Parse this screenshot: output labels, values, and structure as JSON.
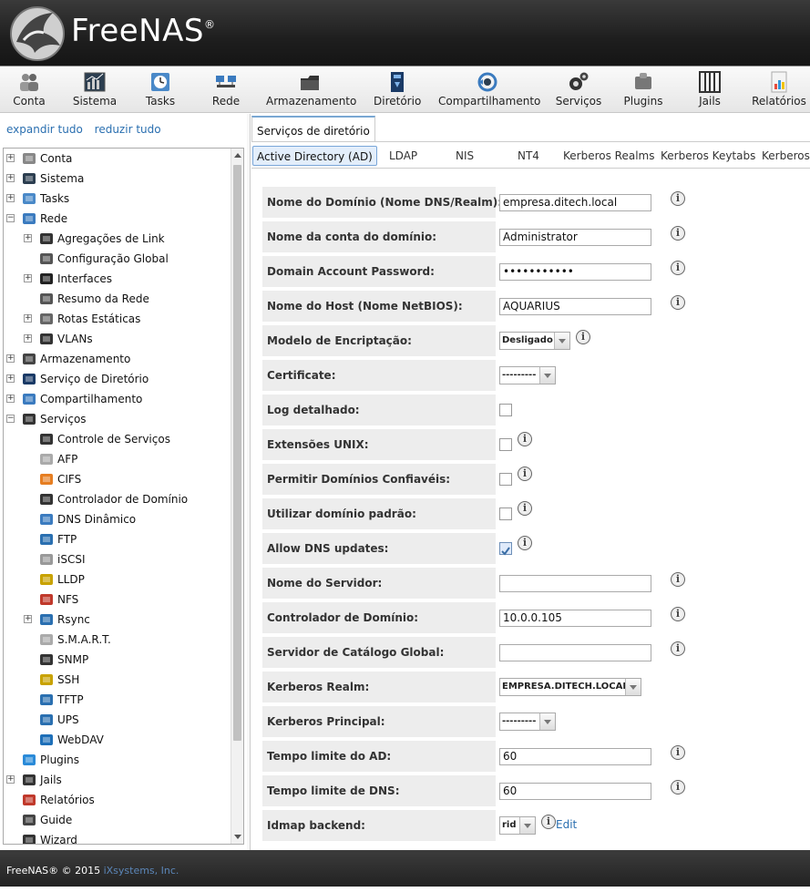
{
  "brand": {
    "name": "FreeNAS",
    "reg": "®"
  },
  "toolbar": [
    {
      "label": "Conta",
      "icon": "users-icon"
    },
    {
      "label": "Sistema",
      "icon": "system-icon"
    },
    {
      "label": "Tasks",
      "icon": "tasks-icon"
    },
    {
      "label": "Rede",
      "icon": "network-icon"
    },
    {
      "label": "Armazenamento",
      "icon": "storage-icon"
    },
    {
      "label": "Diretório",
      "icon": "directory-icon"
    },
    {
      "label": "Compartilhamento",
      "icon": "sharing-icon"
    },
    {
      "label": "Serviços",
      "icon": "services-icon"
    },
    {
      "label": "Plugins",
      "icon": "plugins-icon"
    },
    {
      "label": "Jails",
      "icon": "jails-icon"
    },
    {
      "label": "Relatórios",
      "icon": "reports-icon"
    }
  ],
  "sidebar": {
    "expand_all": "expandir tudo",
    "collapse_all": "reduzir tudo",
    "tree": [
      {
        "label": "Conta",
        "level": 0,
        "exp": "+",
        "icon": "users-icon"
      },
      {
        "label": "Sistema",
        "level": 0,
        "exp": "+",
        "icon": "system-icon"
      },
      {
        "label": "Tasks",
        "level": 0,
        "exp": "+",
        "icon": "tasks-icon"
      },
      {
        "label": "Rede",
        "level": 0,
        "exp": "-",
        "icon": "network-icon"
      },
      {
        "label": "Agregações de Link",
        "level": 1,
        "exp": "+",
        "icon": "link-aggregation-icon"
      },
      {
        "label": "Configuração Global",
        "level": 1,
        "exp": "",
        "icon": "wrench-icon"
      },
      {
        "label": "Interfaces",
        "level": 1,
        "exp": "+",
        "icon": "interface-icon"
      },
      {
        "label": "Resumo da Rede",
        "level": 1,
        "exp": "",
        "icon": "wrench-icon"
      },
      {
        "label": "Rotas Estáticas",
        "level": 1,
        "exp": "+",
        "icon": "routes-icon"
      },
      {
        "label": "VLANs",
        "level": 1,
        "exp": "+",
        "icon": "vlan-icon"
      },
      {
        "label": "Armazenamento",
        "level": 0,
        "exp": "+",
        "icon": "storage-icon"
      },
      {
        "label": "Serviço de Diretório",
        "level": 0,
        "exp": "+",
        "icon": "directory-icon"
      },
      {
        "label": "Compartilhamento",
        "level": 0,
        "exp": "+",
        "icon": "sharing-icon"
      },
      {
        "label": "Serviços",
        "level": 0,
        "exp": "-",
        "icon": "services-icon"
      },
      {
        "label": "Controle de Serviços",
        "level": 1,
        "exp": "",
        "icon": "services-icon"
      },
      {
        "label": "AFP",
        "level": 1,
        "exp": "",
        "icon": "apple-icon"
      },
      {
        "label": "CIFS",
        "level": 1,
        "exp": "",
        "icon": "windows-icon"
      },
      {
        "label": "Controlador de Domínio",
        "level": 1,
        "exp": "",
        "icon": "domain-controller-icon"
      },
      {
        "label": "DNS Dinâmico",
        "level": 1,
        "exp": "",
        "icon": "network-icon"
      },
      {
        "label": "FTP",
        "level": 1,
        "exp": "",
        "icon": "ftp-icon"
      },
      {
        "label": "iSCSI",
        "level": 1,
        "exp": "",
        "icon": "iscsi-icon"
      },
      {
        "label": "LLDP",
        "level": 1,
        "exp": "",
        "icon": "magnifier-icon"
      },
      {
        "label": "NFS",
        "level": 1,
        "exp": "",
        "icon": "nfs-icon"
      },
      {
        "label": "Rsync",
        "level": 1,
        "exp": "+",
        "icon": "rsync-icon"
      },
      {
        "label": "S.M.A.R.T.",
        "level": 1,
        "exp": "",
        "icon": "smart-icon"
      },
      {
        "label": "SNMP",
        "level": 1,
        "exp": "",
        "icon": "snmp-icon"
      },
      {
        "label": "SSH",
        "level": 1,
        "exp": "",
        "icon": "ssh-icon"
      },
      {
        "label": "TFTP",
        "level": 1,
        "exp": "",
        "icon": "tftp-icon"
      },
      {
        "label": "UPS",
        "level": 1,
        "exp": "",
        "icon": "ups-icon"
      },
      {
        "label": "WebDAV",
        "level": 1,
        "exp": "",
        "icon": "globe-icon"
      },
      {
        "label": "Plugins",
        "level": 0,
        "exp": "",
        "icon": "plugins-icon"
      },
      {
        "label": "Jails",
        "level": 0,
        "exp": "+",
        "icon": "jails-icon"
      },
      {
        "label": "Relatórios",
        "level": 0,
        "exp": "",
        "icon": "reports-icon"
      },
      {
        "label": "Guide",
        "level": 0,
        "exp": "",
        "icon": "guide-icon"
      },
      {
        "label": "Wizard",
        "level": 0,
        "exp": "",
        "icon": "wizard-icon"
      }
    ]
  },
  "main": {
    "tab": "Serviços de diretório",
    "subtabs": [
      "Active Directory (AD)",
      "LDAP",
      "NIS",
      "NT4",
      "Kerberos Realms",
      "Kerberos Keytabs",
      "Kerberos"
    ],
    "active_subtab": 0,
    "fields": [
      {
        "label": "Nome do Domínio (Nome DNS/Realm):",
        "type": "text",
        "value": "empresa.ditech.local",
        "info": true
      },
      {
        "label": "Nome da conta do domínio:",
        "type": "text",
        "value": "Administrator",
        "info": true
      },
      {
        "label": "Domain Account Password:",
        "type": "password",
        "value": "•••••••••••",
        "info": true
      },
      {
        "label": "Nome do Host (Nome NetBIOS):",
        "type": "text",
        "value": "AQUARIUS",
        "info": true
      },
      {
        "label": "Modelo de Encriptação:",
        "type": "select",
        "value": "Desligado",
        "info": true
      },
      {
        "label": "Certificate:",
        "type": "select",
        "value": "---------",
        "info": false
      },
      {
        "label": "Log detalhado:",
        "type": "checkbox",
        "checked": false,
        "info": false
      },
      {
        "label": "Extensões UNIX:",
        "type": "checkbox",
        "checked": false,
        "info": true
      },
      {
        "label": "Permitir Domínios Confiavéis:",
        "type": "checkbox",
        "checked": false,
        "info": true
      },
      {
        "label": "Utilizar domínio padrão:",
        "type": "checkbox",
        "checked": false,
        "info": true
      },
      {
        "label": "Allow DNS updates:",
        "type": "checkbox",
        "checked": true,
        "info": true
      },
      {
        "label": "Nome do Servidor:",
        "type": "text",
        "value": "",
        "info": true
      },
      {
        "label": "Controlador de Domínio:",
        "type": "text",
        "value": "10.0.0.105",
        "info": true
      },
      {
        "label": "Servidor de Catálogo Global:",
        "type": "text",
        "value": "",
        "info": true
      },
      {
        "label": "Kerberos Realm:",
        "type": "select",
        "value": "EMPRESA.DITECH.LOCAL",
        "info": false
      },
      {
        "label": "Kerberos Principal:",
        "type": "select",
        "value": "---------",
        "info": false
      },
      {
        "label": "Tempo limite do AD:",
        "type": "text",
        "value": "60",
        "info": true
      },
      {
        "label": "Tempo limite de DNS:",
        "type": "text",
        "value": "60",
        "info": true
      },
      {
        "label": "Idmap backend:",
        "type": "select",
        "value": "rid",
        "info": true,
        "edit": "Edit"
      }
    ]
  },
  "footer": {
    "text": "FreeNAS® © 2015 ",
    "company": "iXsystems, Inc."
  },
  "colors": {
    "link": "#2a6fb0",
    "header": "#1e1e1e",
    "row_bg": "#ededed"
  }
}
